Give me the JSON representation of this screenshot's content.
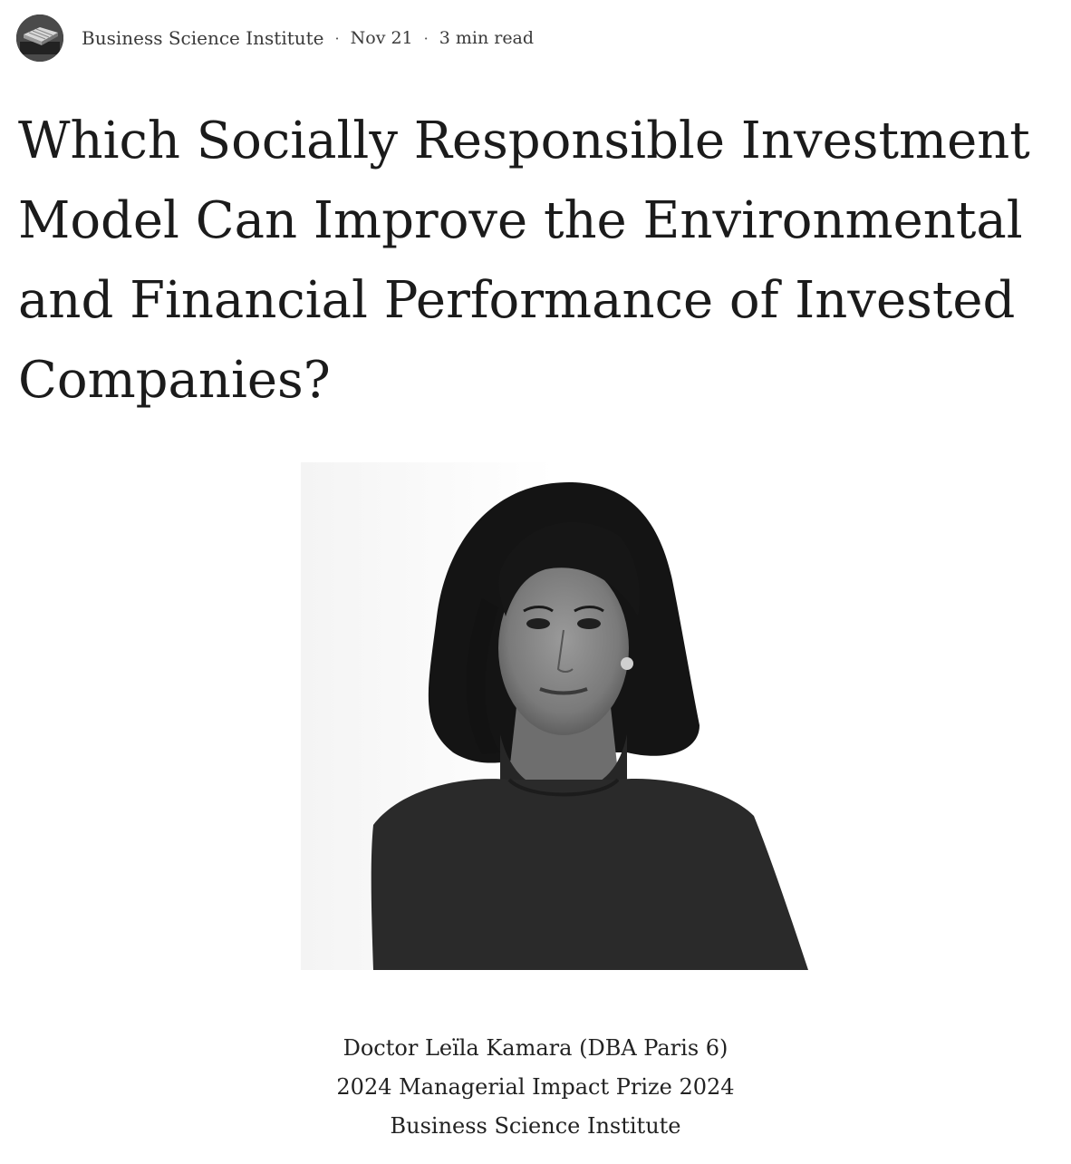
{
  "header": {
    "author_name": "Business Science Institute",
    "separator": "·",
    "date": "Nov 21",
    "read_time": "3 min read"
  },
  "article": {
    "title": "Which Socially Responsible Investment Model Can Improve the Environmental and Financial Performance of Invested Companies?"
  },
  "caption": {
    "lines": [
      "Doctor Leïla Kamara (DBA Paris 6)",
      "2024 Managerial Impact Prize 2024",
      "Business Science Institute"
    ]
  },
  "colors": {
    "text": "#1b1b1b",
    "meta_text": "#3a3a3a",
    "background": "#ffffff"
  }
}
